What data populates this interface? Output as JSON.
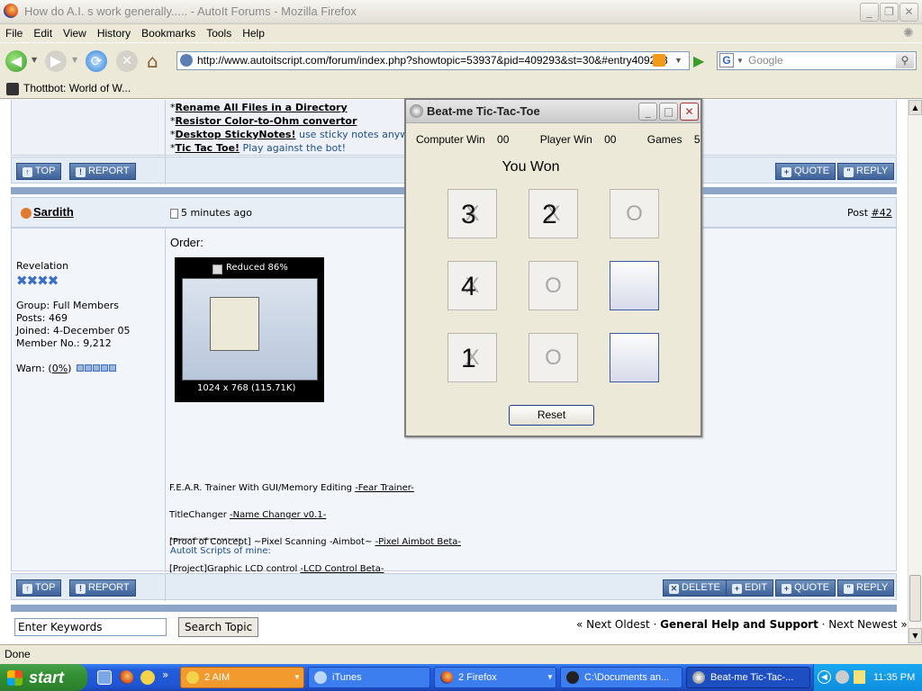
{
  "window": {
    "title": "How do A.I. s work generally..... - AutoIt Forums - Mozilla Firefox"
  },
  "menu": [
    "File",
    "Edit",
    "View",
    "History",
    "Bookmarks",
    "Tools",
    "Help"
  ],
  "nav": {
    "url": "http://www.autoitscript.com/forum/index.php?showtopic=53937&pid=409293&st=30&#entry409293",
    "search_placeholder": "Google"
  },
  "bookmarks": {
    "item1": "Thottbot: World of W..."
  },
  "top_post": {
    "links": [
      {
        "star": "*",
        "link": "Rename All Files in a Directory",
        "rest": ""
      },
      {
        "star": "*",
        "link": "Resistor Color-to-Ohm convertor",
        "rest": ""
      },
      {
        "star": "*",
        "link": "Desktop StickyNotes!",
        "rest": " use sticky notes anywh"
      },
      {
        "star": "*",
        "link": "Tic Tac Toe!",
        "rest": " Play against the bot!"
      }
    ]
  },
  "buttons": {
    "top": "TOP",
    "report": "REPORT",
    "quote": "QUOTE",
    "reply": "REPLY",
    "delete": "DELETE",
    "edit": "EDIT"
  },
  "post": {
    "author": "Sardith",
    "time": "5 minutes ago",
    "post_label": "Post ",
    "post_num": "#42",
    "rank": "Revelation",
    "group": "Group: Full Members",
    "posts": "Posts: 469",
    "joined": "Joined: 4-December 05",
    "member_no": "Member No.: 9,212",
    "warn_prefix": "Warn: (",
    "warn_pct": "0%",
    "warn_suffix": ")",
    "order": "Order:",
    "thumb_label": "Reduced 86%",
    "thumb_size": "1024 x 768 (115.71K)",
    "divider": "--------------------",
    "scripts_title": "AutoIt Scripts of mine:",
    "lines": [
      {
        "text": "F.E.A.R. Trainer With GUI/Memory Editing ",
        "link": "-Fear Trainer-"
      },
      {
        "text": "TitleChanger ",
        "link": "-Name Changer v0.1-"
      },
      {
        "text": "[Proof of Concept] ~Pixel Scanning -Aimbot~ ",
        "link": "-Pixel Aimbot Beta-"
      },
      {
        "text": "[Project]Graphic LCD control ",
        "link": "-LCD Control Beta-"
      }
    ]
  },
  "footer": {
    "search_value": "Enter Keywords",
    "search_button": "Search Topic",
    "prev": "« Next Oldest",
    "dot1": " · ",
    "forum": "General Help and Support",
    "dot2": " · ",
    "next": "Next Newest »"
  },
  "status": "Done",
  "dialog": {
    "title": "Beat-me Tic-Tac-Toe",
    "computer_win_label": "Computer Win",
    "computer_win": "00",
    "player_win_label": "Player Win",
    "player_win": "00",
    "games_label": "Games",
    "games": "5",
    "message": "You Won",
    "reset": "Reset",
    "cells": [
      {
        "mark": "X",
        "num": "3"
      },
      {
        "mark": "X",
        "num": "2"
      },
      {
        "mark": "O",
        "num": ""
      },
      {
        "mark": "X",
        "num": "4"
      },
      {
        "mark": "O",
        "num": ""
      },
      {
        "mark": "",
        "num": ""
      },
      {
        "mark": "X",
        "num": "1"
      },
      {
        "mark": "O",
        "num": ""
      },
      {
        "mark": "",
        "num": ""
      }
    ]
  },
  "taskbar": {
    "start": "start",
    "tasks": [
      "2 AIM",
      "iTunes",
      "2 Firefox",
      "C:\\Documents an...",
      "Beat-me Tic-Tac-..."
    ],
    "clock": "11:35 PM"
  }
}
